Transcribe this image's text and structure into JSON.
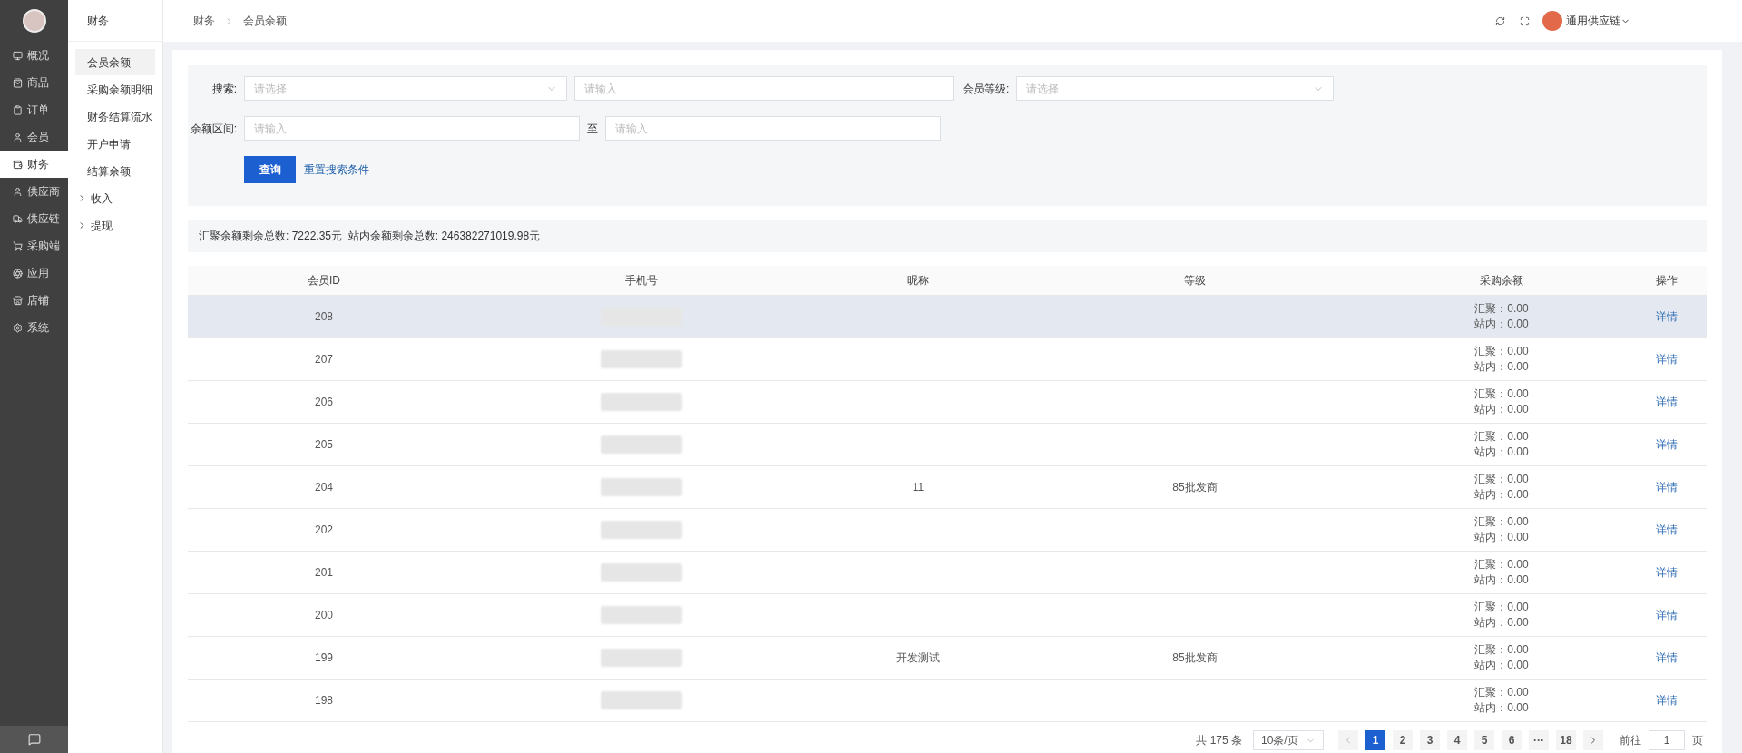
{
  "main_nav": [
    {
      "label": "概况",
      "selected": false
    },
    {
      "label": "商品",
      "selected": false
    },
    {
      "label": "订单",
      "selected": false
    },
    {
      "label": "会员",
      "selected": false
    },
    {
      "label": "财务",
      "selected": true
    },
    {
      "label": "供应商",
      "selected": false
    },
    {
      "label": "供应链",
      "selected": false
    },
    {
      "label": "采购端",
      "selected": false
    },
    {
      "label": "应用",
      "selected": false
    },
    {
      "label": "店铺",
      "selected": false
    },
    {
      "label": "系统",
      "selected": false
    }
  ],
  "sub_nav": {
    "title": "财务",
    "items": [
      {
        "label": "会员余额",
        "selected": true,
        "kind": "link"
      },
      {
        "label": "采购余额明细",
        "selected": false,
        "kind": "link"
      },
      {
        "label": "财务结算流水",
        "selected": false,
        "kind": "link"
      },
      {
        "label": "开户申请",
        "selected": false,
        "kind": "link"
      },
      {
        "label": "结算余额",
        "selected": false,
        "kind": "link"
      },
      {
        "label": "收入",
        "selected": false,
        "kind": "group",
        "expanded": false
      },
      {
        "label": "提现",
        "selected": false,
        "kind": "group",
        "expanded": false
      }
    ]
  },
  "breadcrumb": [
    "财务",
    "会员余额"
  ],
  "header": {
    "org": "通用供应链"
  },
  "search": {
    "search_label": "搜索:",
    "search_select_placeholder": "请选择",
    "search_input_placeholder": "请输入",
    "level_label": "会员等级:",
    "level_placeholder": "请选择",
    "range_label": "余额区间:",
    "range_from_placeholder": "请输入",
    "range_sep": "至",
    "range_to_placeholder": "请输入",
    "query_button": "查询",
    "reset_link": "重置搜索条件"
  },
  "summary": "汇聚余额剩余总数: 7222.35元  站内余额剩余总数: 246382271019.98元",
  "table": {
    "columns": [
      "会员ID",
      "手机号",
      "昵称",
      "等级",
      "采购余额",
      "操作"
    ],
    "rows": [
      {
        "id": "208",
        "nickname": "",
        "level": "",
        "balance": [
          "汇聚：0.00",
          "站内：0.00"
        ],
        "action": "详情",
        "hovered": true
      },
      {
        "id": "207",
        "nickname": "",
        "level": "",
        "balance": [
          "汇聚：0.00",
          "站内：0.00"
        ],
        "action": "详情",
        "hovered": false
      },
      {
        "id": "206",
        "nickname": "",
        "level": "",
        "balance": [
          "汇聚：0.00",
          "站内：0.00"
        ],
        "action": "详情",
        "hovered": false
      },
      {
        "id": "205",
        "nickname": "",
        "level": "",
        "balance": [
          "汇聚：0.00",
          "站内：0.00"
        ],
        "action": "详情",
        "hovered": false
      },
      {
        "id": "204",
        "nickname": "11",
        "level": "85批发商",
        "balance": [
          "汇聚：0.00",
          "站内：0.00"
        ],
        "action": "详情",
        "hovered": false
      },
      {
        "id": "202",
        "nickname": "",
        "level": "",
        "balance": [
          "汇聚：0.00",
          "站内：0.00"
        ],
        "action": "详情",
        "hovered": false
      },
      {
        "id": "201",
        "nickname": "",
        "level": "",
        "balance": [
          "汇聚：0.00",
          "站内：0.00"
        ],
        "action": "详情",
        "hovered": false
      },
      {
        "id": "200",
        "nickname": "",
        "level": "",
        "balance": [
          "汇聚：0.00",
          "站内：0.00"
        ],
        "action": "详情",
        "hovered": false
      },
      {
        "id": "199",
        "nickname": "开发测试",
        "level": "85批发商",
        "balance": [
          "汇聚：0.00",
          "站内：0.00"
        ],
        "action": "详情",
        "hovered": false
      },
      {
        "id": "198",
        "nickname": "",
        "level": "",
        "balance": [
          "汇聚：0.00",
          "站内：0.00"
        ],
        "action": "详情",
        "hovered": false
      }
    ]
  },
  "pagination": {
    "total": "共 175 条",
    "page_size": "10条/页",
    "pages": [
      {
        "label": "1",
        "selected": true
      },
      {
        "label": "2",
        "selected": false
      },
      {
        "label": "3",
        "selected": false
      },
      {
        "label": "4",
        "selected": false
      },
      {
        "label": "5",
        "selected": false
      },
      {
        "label": "6",
        "selected": false
      },
      {
        "label": "···",
        "selected": false
      },
      {
        "label": "18",
        "selected": false
      }
    ],
    "goto_label": "前往",
    "goto_value": "1",
    "goto_suffix": "页"
  }
}
